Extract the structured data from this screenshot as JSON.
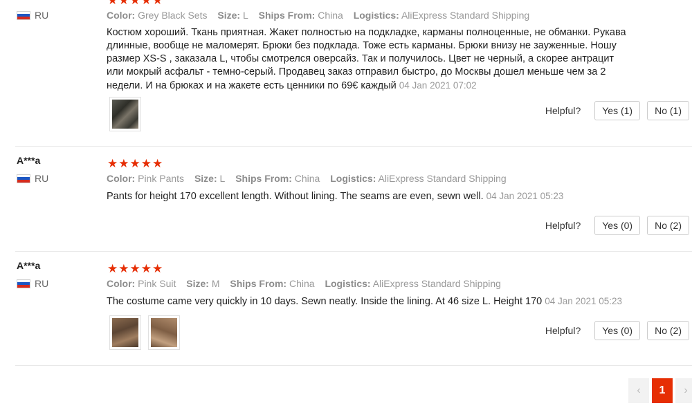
{
  "colors": {
    "star": "#e62e04",
    "active_page": "#e62e04"
  },
  "labels": {
    "color": "Color:",
    "size": "Size:",
    "ships_from": "Ships From:",
    "logistics": "Logistics:",
    "helpful": "Helpful?"
  },
  "reviews": [
    {
      "user": "",
      "country": "RU",
      "stars": "★★★★★",
      "color": "Grey Black Sets",
      "size": "L",
      "ships_from": "China",
      "logistics": "AliExpress Standard Shipping",
      "text": "Костюм хороший. Ткань приятная. Жакет полностью на подкладке, карманы полноценные, не обманки. Рукава длинные, вообще не маломерят. Брюки без подклада. Тоже есть карманы. Брюки внизу не зауженные. Ношу размер XS-S , заказала L, чтобы смотрелся оверсайз. Так и получилось. Цвет не черный, а скорее антрацит или мокрый асфальт - темно-серый. Продавец заказ отправил быстро, до Москвы дошел меньше чем за 2 недели. И на брюках и на жакете есть ценники по 69€ каждый",
      "date": "04 Jan 2021 07:02",
      "yes": "Yes (1)",
      "no": "No (1)"
    },
    {
      "user": "A***a",
      "country": "RU",
      "stars": "★★★★★",
      "color": "Pink Pants",
      "size": "L",
      "ships_from": "China",
      "logistics": "AliExpress Standard Shipping",
      "text": "Pants for height 170 excellent length. Without lining. The seams are even, sewn well.",
      "date": "04 Jan 2021 05:23",
      "yes": "Yes (0)",
      "no": "No (2)"
    },
    {
      "user": "A***a",
      "country": "RU",
      "stars": "★★★★★",
      "color": "Pink Suit",
      "size": "M",
      "ships_from": "China",
      "logistics": "AliExpress Standard Shipping",
      "text": "The costume came very quickly in 10 days. Sewn neatly. Inside the lining. At 46 size L. Height 170",
      "date": "04 Jan 2021 05:23",
      "yes": "Yes (0)",
      "no": "No (2)"
    }
  ],
  "pagination": {
    "prev": "‹",
    "current": "1",
    "next": "›"
  }
}
